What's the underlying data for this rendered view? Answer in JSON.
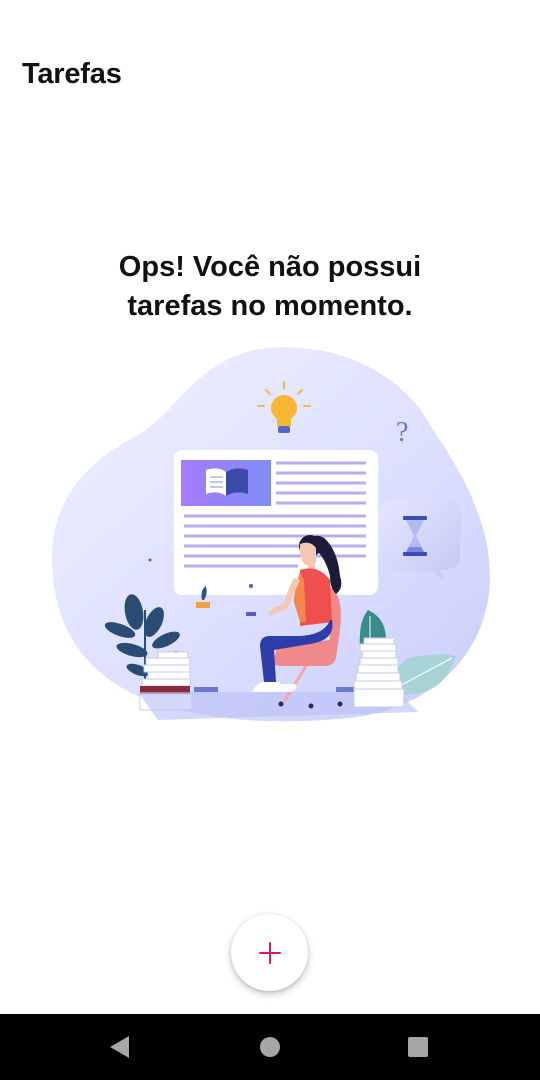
{
  "header": {
    "title": "Tarefas"
  },
  "empty_state": {
    "line1": "Ops! Você não possui",
    "line2": "tarefas no momento.",
    "illustration_icons": [
      "lightbulb-icon",
      "question-mark-icon",
      "hourglass-icon",
      "open-book-icon"
    ],
    "question_mark": "?"
  },
  "fab": {
    "icon": "plus-icon",
    "color": "#d81b60"
  },
  "system_nav": {
    "back_icon": "back-triangle-icon",
    "home_icon": "home-circle-icon",
    "recent_icon": "recent-apps-square-icon"
  },
  "colors": {
    "accent": "#d81b60",
    "background": "#ffffff",
    "blob": "#dfe2ff",
    "purple": "#9b6dff"
  }
}
